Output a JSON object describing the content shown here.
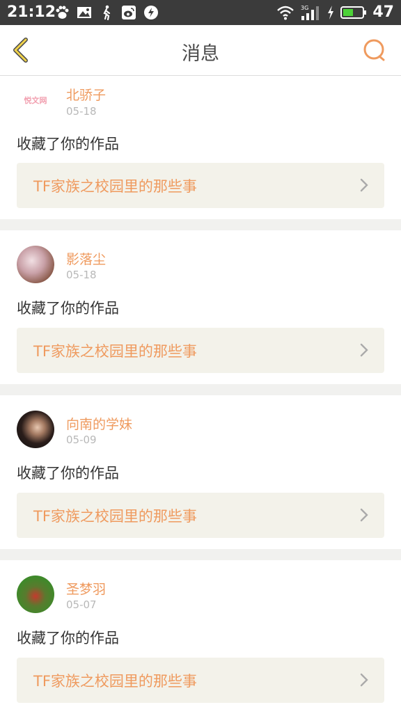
{
  "status_bar": {
    "time": "21:12",
    "battery": "47"
  },
  "header": {
    "title": "消息",
    "back_icon": "back-chevron-icon",
    "search_icon": "search-icon"
  },
  "colors": {
    "accent": "#ef9a5e",
    "link_bg": "#f3f2ea",
    "status_bg": "#3b3b3b"
  },
  "messages": [
    {
      "username": "北骄子",
      "date": "05-18",
      "action": "收藏了你的作品",
      "work": "TF家族之校园里的那些事",
      "avatar_text": "悦文网"
    },
    {
      "username": "影落尘",
      "date": "05-18",
      "action": "收藏了你的作品",
      "work": "TF家族之校园里的那些事"
    },
    {
      "username": "向南的学妹",
      "date": "05-09",
      "action": "收藏了你的作品",
      "work": "TF家族之校园里的那些事"
    },
    {
      "username": "圣梦羽",
      "date": "05-07",
      "action": "收藏了你的作品",
      "work": "TF家族之校园里的那些事"
    }
  ]
}
